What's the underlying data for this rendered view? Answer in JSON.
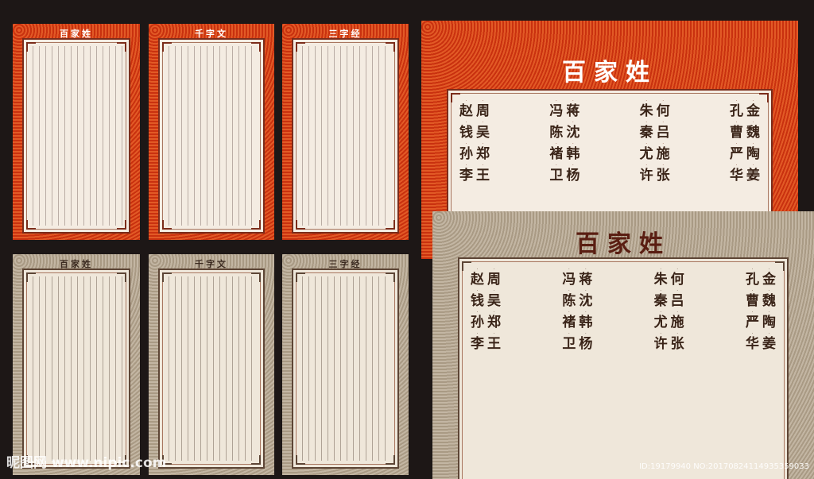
{
  "small_panels": [
    {
      "title": "百家姓",
      "theme": "red"
    },
    {
      "title": "千字文",
      "theme": "red"
    },
    {
      "title": "三字经",
      "theme": "red"
    },
    {
      "title": "百家姓",
      "theme": "tan"
    },
    {
      "title": "千字文",
      "theme": "tan"
    },
    {
      "title": "三字经",
      "theme": "tan"
    }
  ],
  "big_red": {
    "title": "百家姓",
    "groups": [
      [
        [
          "赵",
          "钱",
          "孙",
          "李"
        ],
        [
          "周",
          "吴",
          "郑",
          "王"
        ]
      ],
      [
        [
          "冯",
          "陈",
          "褚",
          "卫"
        ],
        [
          "蒋",
          "沈",
          "韩",
          "杨"
        ]
      ],
      [
        [
          "朱",
          "秦",
          "尤",
          "许"
        ],
        [
          "何",
          "吕",
          "施",
          "张"
        ]
      ],
      [
        [
          "孔",
          "曹",
          "严",
          "华"
        ],
        [
          "金",
          "魏",
          "陶",
          "姜"
        ]
      ]
    ]
  },
  "big_tan": {
    "title": "百家姓",
    "groups": [
      [
        [
          "赵",
          "钱",
          "孙",
          "李"
        ],
        [
          "周",
          "吴",
          "郑",
          "王"
        ]
      ],
      [
        [
          "冯",
          "陈",
          "褚",
          "卫"
        ],
        [
          "蒋",
          "沈",
          "韩",
          "杨"
        ]
      ],
      [
        [
          "朱",
          "秦",
          "尤",
          "许"
        ],
        [
          "何",
          "吕",
          "施",
          "张"
        ]
      ],
      [
        [
          "孔",
          "曹",
          "严",
          "华"
        ],
        [
          "金",
          "魏",
          "陶",
          "姜"
        ]
      ]
    ]
  },
  "watermark": {
    "left": "昵图网 www.nipic.com",
    "right": "ID:19179940 NO:20170824114935359033"
  }
}
